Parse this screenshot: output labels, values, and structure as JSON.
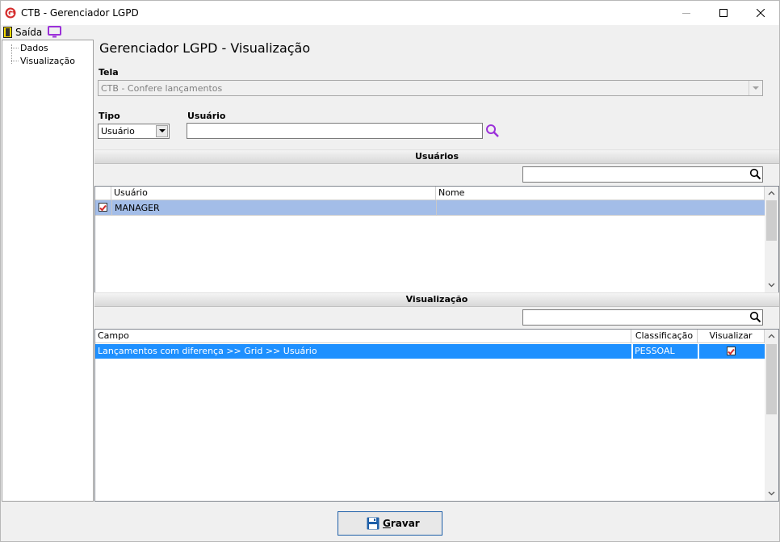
{
  "window": {
    "title": "CTB - Gerenciador LGPD"
  },
  "menu": {
    "exit_label": "Saída"
  },
  "tree": {
    "items": [
      "Dados",
      "Visualização"
    ]
  },
  "main": {
    "heading": "Gerenciador LGPD - Visualização",
    "tela": {
      "label": "Tela",
      "value": "CTB - Confere lançamentos"
    },
    "tipo": {
      "label": "Tipo",
      "value": "Usuário"
    },
    "usuario": {
      "label": "Usuário",
      "value": ""
    }
  },
  "users_section": {
    "title": "Usuários",
    "search_value": "",
    "columns": [
      "Usuário",
      "Nome"
    ],
    "rows": [
      {
        "checked": true,
        "usuario": "MANAGER",
        "nome": ""
      }
    ]
  },
  "view_section": {
    "title": "Visualização",
    "search_value": "",
    "columns": [
      "Campo",
      "Classificação",
      "Visualizar"
    ],
    "rows": [
      {
        "campo": "Lançamentos com diferença >> Grid >> Usuário",
        "classificacao": "PESSOAL",
        "visualizar": true
      }
    ]
  },
  "footer": {
    "save_label": "Gravar"
  },
  "colors": {
    "selected_row_users": "#a3bde8",
    "selected_row_view": "#1e90ff",
    "icon_purple": "#9b30d9",
    "logo_red": "#d42b2b"
  }
}
